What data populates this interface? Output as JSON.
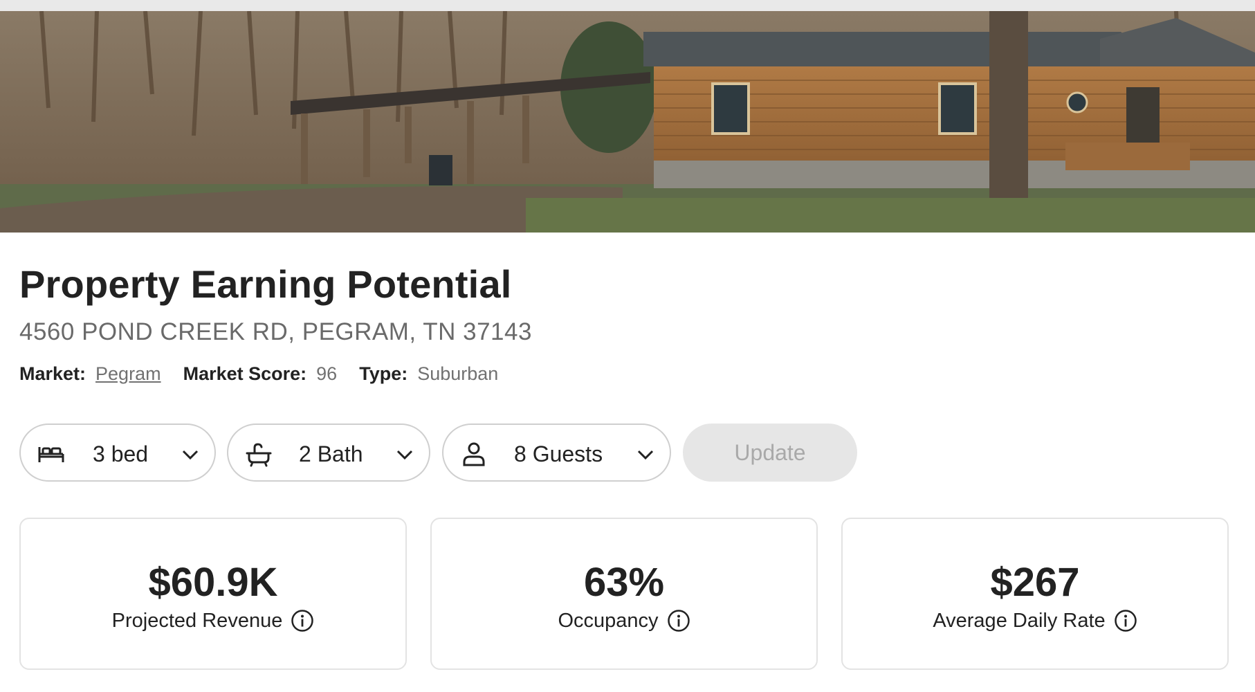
{
  "property": {
    "title": "Property Earning Potential",
    "address": "4560 POND CREEK RD, PEGRAM, TN 37143"
  },
  "meta": {
    "market_label": "Market:",
    "market_value": "Pegram",
    "score_label": "Market Score:",
    "score_value": "96",
    "type_label": "Type:",
    "type_value": "Suburban"
  },
  "controls": {
    "bedrooms": {
      "label": "3 bed",
      "icon": "bed-icon"
    },
    "bathrooms": {
      "label": "2 Bath",
      "icon": "bathtub-icon"
    },
    "guests": {
      "label": "8 Guests",
      "icon": "person-icon"
    },
    "update_label": "Update"
  },
  "metrics": [
    {
      "value": "$60.9K",
      "label": "Projected Revenue",
      "icon": "info-icon"
    },
    {
      "value": "63%",
      "label": "Occupancy",
      "icon": "info-icon"
    },
    {
      "value": "$267",
      "label": "Average Daily Rate",
      "icon": "info-icon"
    }
  ],
  "colors": {
    "text": "#222222",
    "muted": "#717171",
    "border": "#cfcfcf",
    "update_bg": "#e6e6e6",
    "update_text": "#a9a9a9"
  }
}
